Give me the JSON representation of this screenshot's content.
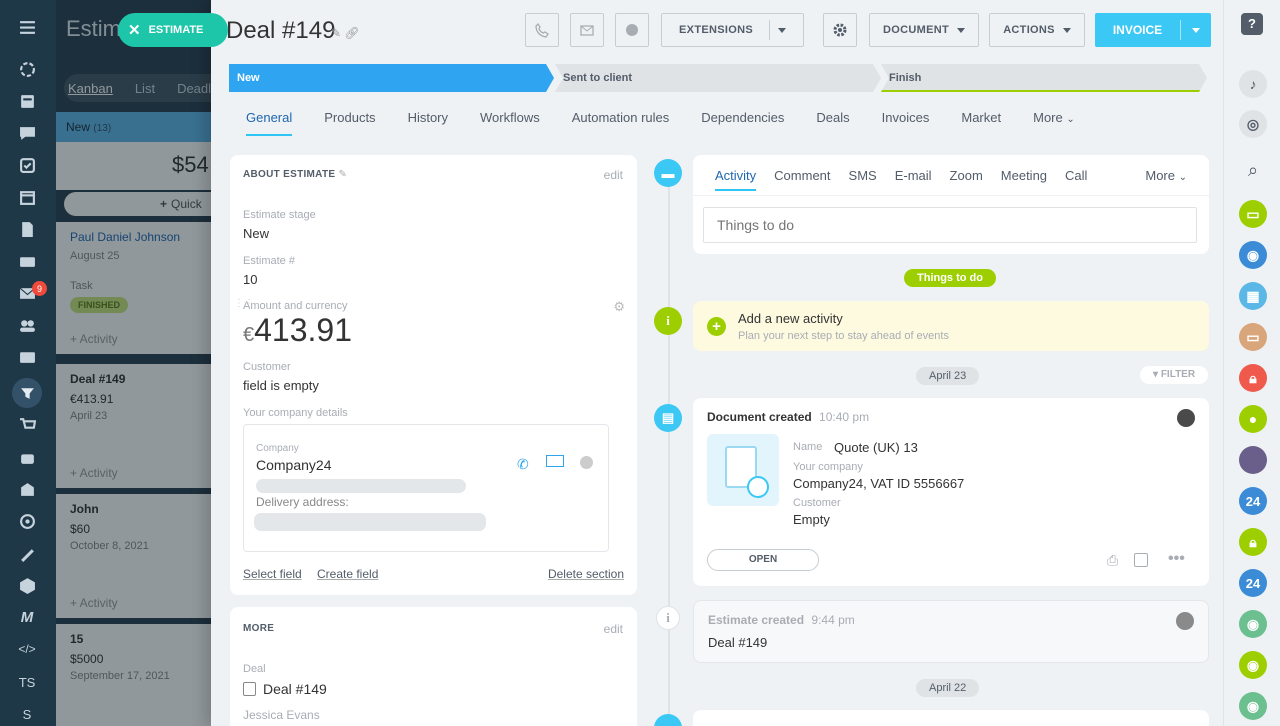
{
  "left_nav": {
    "badge": "9",
    "ts": "TS",
    "s": "S"
  },
  "background": {
    "title": "Estim",
    "estimate_button": "ESTIMATE",
    "tabs": [
      "Kanban",
      "List",
      "Deadl"
    ],
    "column": {
      "name": "New",
      "count": "(13)",
      "sum": "$54",
      "quick": "Quick"
    },
    "cards": [
      {
        "name": "Paul Daniel Johnson",
        "date": "August 25",
        "task": "Task",
        "status": "FINISHED",
        "activity": "+ Activity"
      },
      {
        "name": "Deal #149",
        "amount": "€413.91",
        "date": "April 23",
        "activity": "+ Activity"
      },
      {
        "name": "John",
        "amount": "$60",
        "date": "October 8, 2021",
        "activity": "+ Activity"
      },
      {
        "name": "15",
        "amount": "$5000",
        "date": "September 17, 2021"
      }
    ]
  },
  "header": {
    "title": "Deal #149",
    "buttons": {
      "extensions": "EXTENSIONS",
      "document": "DOCUMENT",
      "actions": "ACTIONS",
      "invoice": "INVOICE"
    }
  },
  "stages": [
    "New",
    "Sent to client",
    "Finish"
  ],
  "tabs": [
    "General",
    "Products",
    "History",
    "Workflows",
    "Automation rules",
    "Dependencies",
    "Deals",
    "Invoices",
    "Market",
    "More"
  ],
  "about": {
    "section": "ABOUT ESTIMATE",
    "edit": "edit",
    "stage_label": "Estimate stage",
    "stage": "New",
    "num_label": "Estimate #",
    "num": "10",
    "amount_label": "Amount and currency",
    "currency": "€",
    "amount": "413.91",
    "customer_label": "Customer",
    "customer": "field is empty",
    "company_details_label": "Your company details",
    "company_label": "Company",
    "company": "Company24",
    "delivery_label": "Delivery address:",
    "select_field": "Select field",
    "create_field": "Create field",
    "delete_section": "Delete section"
  },
  "more": {
    "section": "MORE",
    "edit": "edit",
    "deal_label": "Deal",
    "deal": "Deal #149",
    "person": "Jessica Evans"
  },
  "activity": {
    "tabs": [
      "Activity",
      "Comment",
      "SMS",
      "E-mail",
      "Zoom",
      "Meeting",
      "Call",
      "More"
    ],
    "placeholder": "Things to do",
    "things_to_do": "Things to do",
    "add_title": "Add a new activity",
    "add_sub": "Plan your next step to stay ahead of events"
  },
  "timeline": {
    "date1": "April 23",
    "filter": "FILTER",
    "doc_title": "Document created",
    "doc_time": "10:40 pm",
    "name_label": "Name",
    "name": "Quote (UK) 13",
    "company_label": "Your company",
    "company": "Company24, VAT ID 5556667",
    "customer_label": "Customer",
    "customer": "Empty",
    "open": "OPEN",
    "est_title": "Estimate created",
    "est_time": "9:44 pm",
    "est_deal": "Deal #149",
    "date2": "April 22"
  },
  "right_bar": {
    "n24": "24"
  },
  "colors": {
    "accent": "#3bc8f5",
    "stage_active": "#2fa4f0",
    "green": "#9dcf00",
    "nav_bg": "#1f3848"
  }
}
